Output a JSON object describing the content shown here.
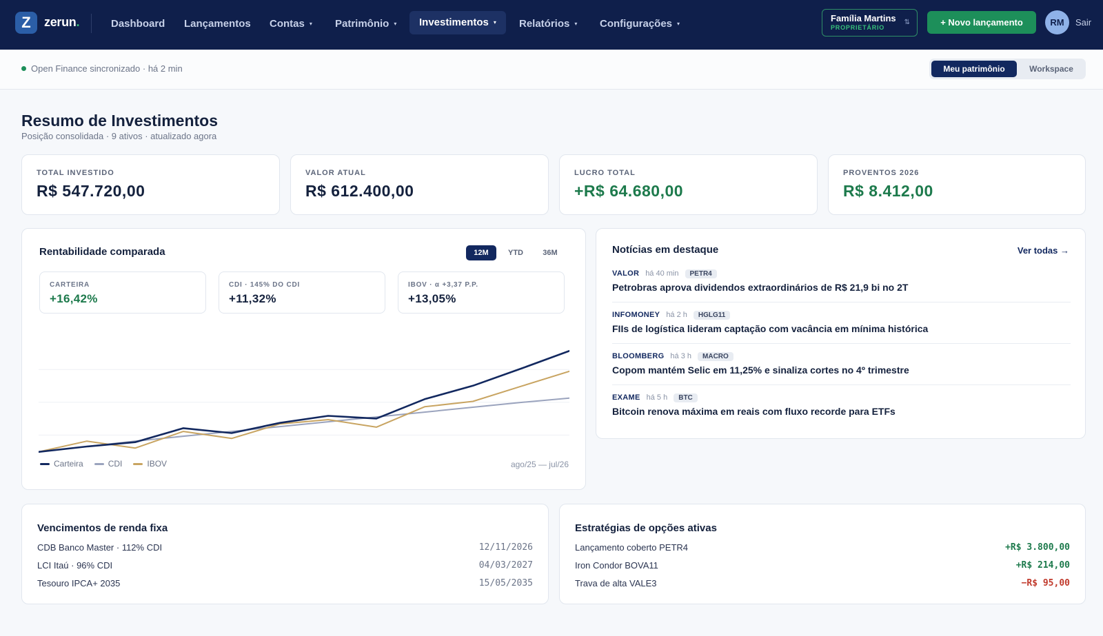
{
  "brand": {
    "logo_letter": "Z",
    "name": "zerun",
    "dot": "."
  },
  "nav": {
    "items": [
      {
        "label": "Dashboard",
        "caret": ""
      },
      {
        "label": "Lançamentos",
        "caret": ""
      },
      {
        "label": "Contas",
        "caret": "▾"
      },
      {
        "label": "Patrimônio",
        "caret": "▾"
      },
      {
        "label": "Investimentos",
        "caret": "▾"
      },
      {
        "label": "Relatórios",
        "caret": "▾"
      },
      {
        "label": "Configurações",
        "caret": "▾"
      }
    ],
    "active_index": 4
  },
  "account": {
    "name": "Família Martins",
    "role": "PROPRIETÁRIO",
    "sort_icon": "⇅"
  },
  "actions": {
    "new_entry": "+ Novo lançamento",
    "avatar_initials": "RM",
    "logout": "Sair"
  },
  "subbar": {
    "sync_text": "Open Finance sincronizado · há 2 min",
    "toggle_on": "Meu patrimônio",
    "toggle_off": "Workspace"
  },
  "page": {
    "title": "Resumo de Investimentos",
    "subtitle": "Posição consolidada · 9 ativos · atualizado agora"
  },
  "kpis": [
    {
      "label": "TOTAL INVESTIDO",
      "value": "R$ 547.720,00"
    },
    {
      "label": "VALOR ATUAL",
      "value": "R$ 612.400,00"
    },
    {
      "label": "LUCRO TOTAL",
      "value": "+R$ 64.680,00"
    },
    {
      "label": "PROVENTOS 2026",
      "value": "R$ 8.412,00"
    }
  ],
  "performance": {
    "title": "Rentabilidade comparada",
    "ranges": [
      "12M",
      "YTD",
      "36M"
    ],
    "active_range": 0,
    "stats": [
      {
        "label": "CARTEIRA",
        "value": "+16,42%"
      },
      {
        "label": "CDI · 145% DO CDI",
        "value": "+11,32%"
      },
      {
        "label": "IBOV · α +3,37 P.P.",
        "value": "+13,05%"
      }
    ],
    "period": "ago/25 — jul/26"
  },
  "chart_data": {
    "type": "line",
    "x": [
      1,
      2,
      3,
      4,
      5,
      6,
      7,
      8,
      9,
      10,
      11,
      12
    ],
    "series": [
      {
        "name": "Carteira",
        "color": "#12285f",
        "values": [
          0.0,
          1.0,
          1.8,
          4.4,
          3.5,
          5.4,
          6.7,
          6.2,
          9.8,
          12.3,
          15.5,
          18.8
        ]
      },
      {
        "name": "CDI",
        "color": "#9aa3bd",
        "values": [
          0.0,
          1.0,
          2.0,
          2.9,
          3.8,
          4.7,
          5.6,
          6.5,
          7.4,
          8.3,
          9.2,
          10.0
        ]
      },
      {
        "name": "IBOV",
        "color": "#c8a461",
        "values": [
          0.0,
          2.0,
          0.7,
          3.8,
          2.5,
          5.2,
          6.0,
          4.6,
          8.4,
          9.4,
          12.2,
          15.0
        ]
      }
    ],
    "ylim": [
      -0.8,
      21.0
    ],
    "grid": true,
    "legend": "bottom-left"
  },
  "news": {
    "title": "Notícias em destaque",
    "see_all": "Ver todas →",
    "items": [
      {
        "source": "VALOR",
        "time": "há 40 min",
        "tag": "PETR4",
        "headline": "Petrobras aprova dividendos extraordinários de R$ 21,9 bi no 2T"
      },
      {
        "source": "INFOMONEY",
        "time": "há 2 h",
        "tag": "HGLG11",
        "headline": "FIIs de logística lideram captação com vacância em mínima histórica"
      },
      {
        "source": "BLOOMBERG",
        "time": "há 3 h",
        "tag": "MACRO",
        "headline": "Copom mantém Selic em 11,25% e sinaliza cortes no 4º trimestre"
      },
      {
        "source": "EXAME",
        "time": "há 5 h",
        "tag": "BTC",
        "headline": "Bitcoin renova máxima em reais com fluxo recorde para ETFs"
      }
    ]
  },
  "fixed_income": {
    "title": "Vencimentos de renda fixa",
    "rows": [
      {
        "name": "CDB Banco Master · 112% CDI",
        "date": "12/11/2026"
      },
      {
        "name": "LCI Itaú · 96% CDI",
        "date": "04/03/2027"
      },
      {
        "name": "Tesouro IPCA+ 2035",
        "date": "15/05/2035"
      }
    ]
  },
  "options": {
    "title": "Estratégias de opções ativas",
    "rows": [
      {
        "name": "Lançamento coberto PETR4",
        "value": "+R$ 3.800,00",
        "sign": "pos"
      },
      {
        "name": "Iron Condor BOVA11",
        "value": "+R$ 214,00",
        "sign": "pos"
      },
      {
        "name": "Trava de alta VALE3",
        "value": "−R$ 95,00",
        "sign": "neg"
      }
    ]
  }
}
